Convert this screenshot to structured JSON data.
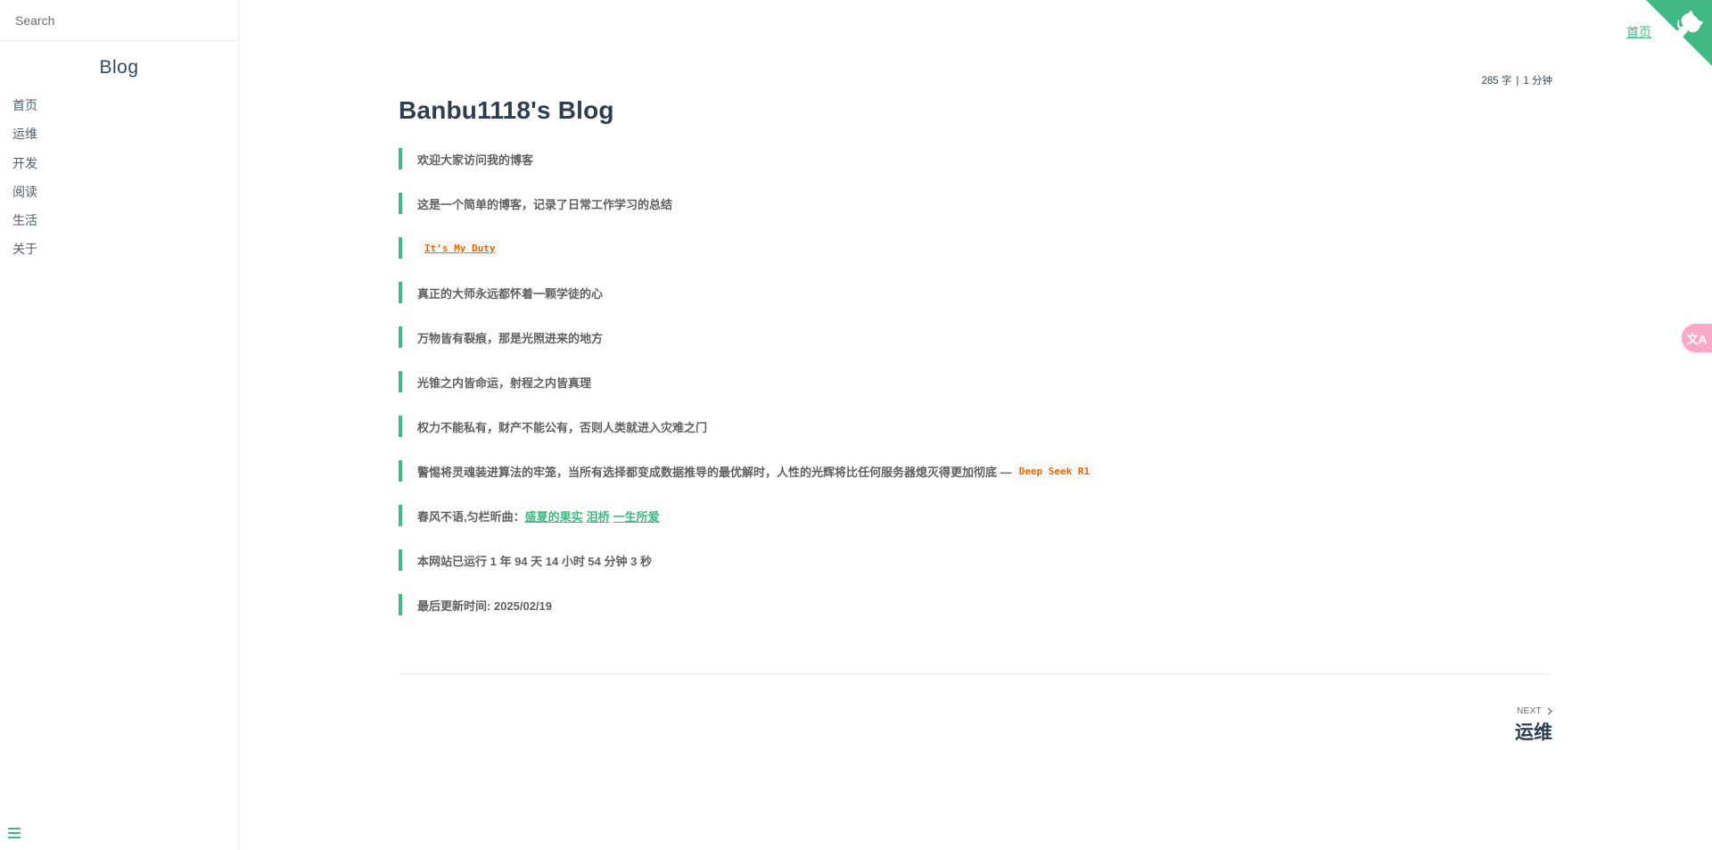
{
  "sidebar": {
    "search_placeholder": "Search",
    "app_name": "Blog",
    "items": [
      {
        "label": "首页"
      },
      {
        "label": "运维"
      },
      {
        "label": "开发"
      },
      {
        "label": "阅读"
      },
      {
        "label": "生活"
      },
      {
        "label": "关于"
      }
    ]
  },
  "topnav": {
    "home_label": "首页"
  },
  "translate_button": {
    "label": "文A"
  },
  "page": {
    "meta": {
      "words": "285 字",
      "separator": "|",
      "time": "1 分钟"
    },
    "title": "Banbu1118's Blog",
    "quotes": {
      "q1": "欢迎大家访问我的博客",
      "q2": "这是一个简单的博客，记录了日常工作学习的总结",
      "q3_code": "It's My Duty",
      "q4": "真正的大师永远都怀着一颗学徒的心",
      "q5": "万物皆有裂痕，那是光照进来的地方",
      "q6": "光锥之内皆命运，射程之内皆真理",
      "q7": "权力不能私有，财产不能公有，否则人类就进入灾难之门",
      "q8_text": "警惕将灵魂装进算法的牢笼，当所有选择都变成数据推导的最优解时，人性的光辉将比任何服务器熄灭得更加彻底 —",
      "q8_code": "Deep Seek R1",
      "q9_text": "春风不语,匀栏昕曲：",
      "q9_links": [
        "盛夏的果实",
        "泪桥",
        "一生所爱"
      ],
      "q10": "本网站已运行 1 年 94 天 14 小时 54 分钟 3 秒",
      "q11": "最后更新时间: 2025/02/19"
    },
    "pagination": {
      "next_label": "NEXT",
      "next_title": "运维"
    }
  },
  "colors": {
    "accent": "#42b983",
    "title": "#2c3e50",
    "code": "#e96900",
    "translate_bg": "#f9a8c8"
  },
  "icons": {
    "menu": "hamburger-icon",
    "corner": "github-octocat-icon",
    "next": "chevron-right-icon",
    "translate": "translate-icon"
  }
}
